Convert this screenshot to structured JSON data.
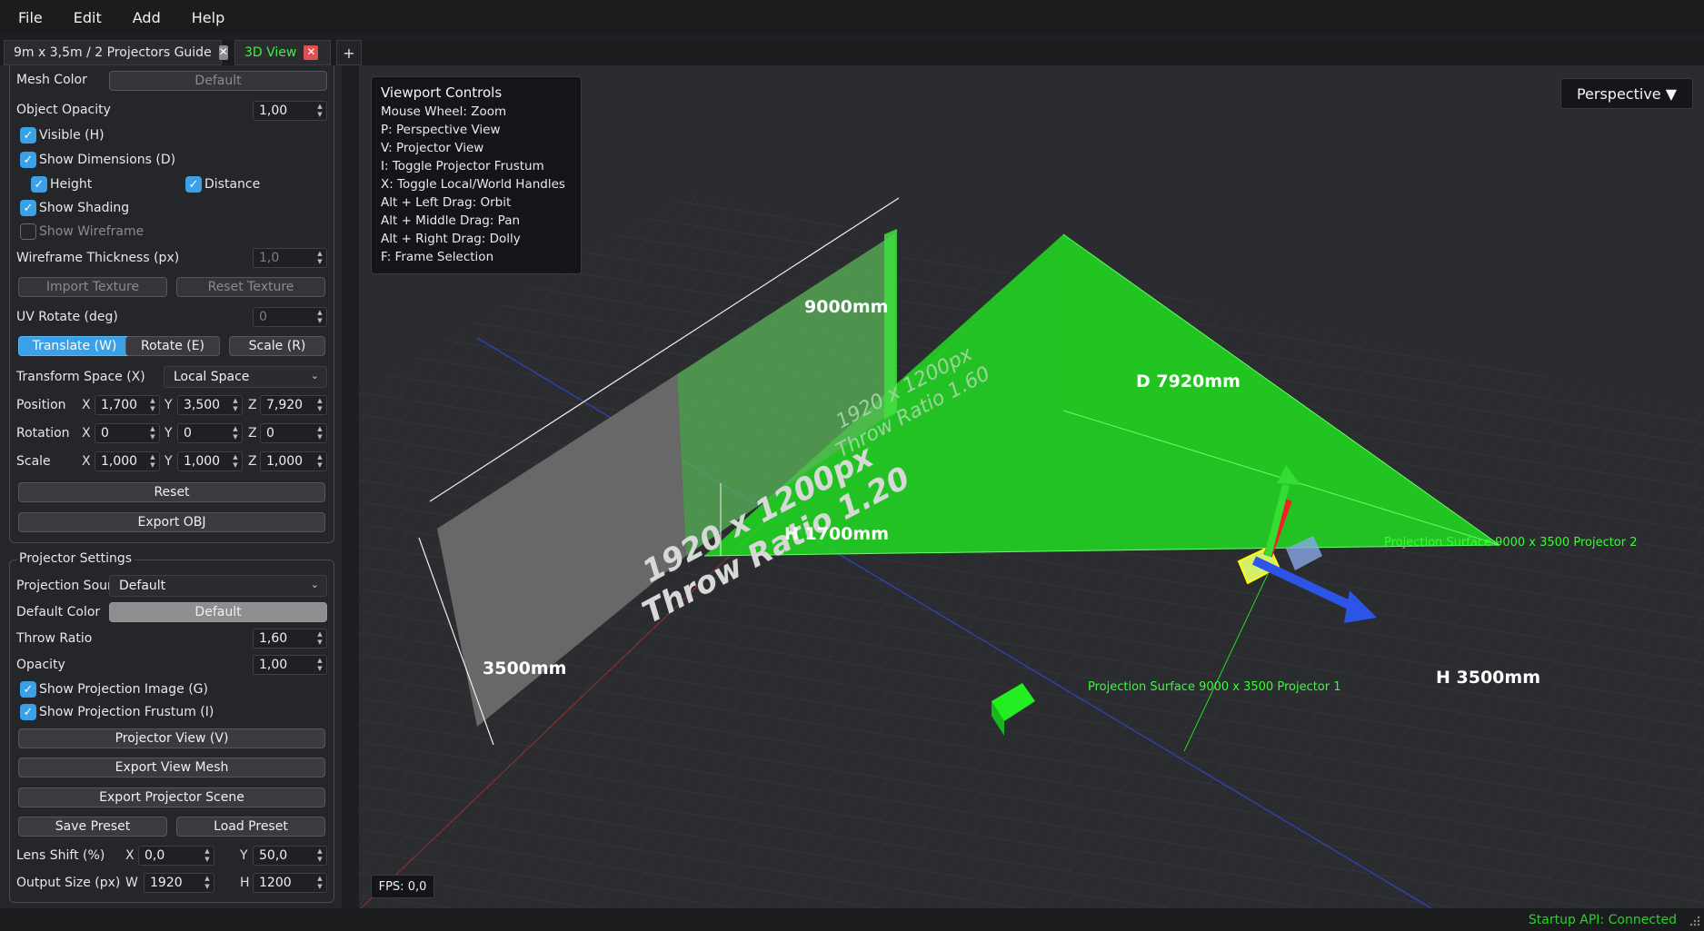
{
  "menu": {
    "file": "File",
    "edit": "Edit",
    "add": "Add",
    "help": "Help"
  },
  "tabs": {
    "guide": "9m x 3,5m / 2 Projectors Guide",
    "view3d": "3D View",
    "close": "✕",
    "add": "+"
  },
  "object": {
    "mesh_color_label": "Mesh Color",
    "mesh_color_button": "Default",
    "opacity_label": "Object Opacity",
    "opacity_value": "1,00",
    "visible": "Visible (H)",
    "show_dimensions": "Show Dimensions (D)",
    "height": "Height",
    "distance": "Distance",
    "show_shading": "Show Shading",
    "show_wireframe": "Show Wireframe",
    "wireframe_label": "Wireframe Thickness (px)",
    "wireframe_value": "1,0",
    "import_texture": "Import Texture",
    "reset_texture": "Reset Texture",
    "uv_rotate_label": "UV Rotate (deg)",
    "uv_rotate_value": "0",
    "translate": "Translate (W)",
    "rotate": "Rotate (E)",
    "scale_btn": "Scale (R)",
    "transform_space_label": "Transform Space (X)",
    "transform_space_value": "Local Space",
    "position_label": "Position",
    "rotation_label": "Rotation",
    "scale_label": "Scale",
    "axis_x": "X",
    "axis_y": "Y",
    "axis_z": "Z",
    "position": {
      "x": "1,700",
      "y": "3,500",
      "z": "7,920"
    },
    "rotation": {
      "x": "0",
      "y": "0",
      "z": "0"
    },
    "scale": {
      "x": "1,000",
      "y": "1,000",
      "z": "1,000"
    },
    "reset": "Reset",
    "export_obj": "Export OBJ"
  },
  "projector": {
    "group_title": "Projector Settings",
    "source_label": "Projection Sour",
    "source_value": "Default",
    "default_color_label": "Default Color",
    "default_color_button": "Default",
    "throw_ratio_label": "Throw Ratio",
    "throw_ratio_value": "1,60",
    "opacity_label": "Opacity",
    "opacity_value": "1,00",
    "show_image": "Show Projection Image (G)",
    "show_frustum": "Show Projection Frustum (I)",
    "projector_view": "Projector View (V)",
    "export_view_mesh": "Export View Mesh",
    "export_scene": "Export Projector Scene",
    "save_preset": "Save Preset",
    "load_preset": "Load Preset",
    "lens_shift_label": "Lens Shift (%)",
    "lens_x": "0,0",
    "lens_y": "50,0",
    "output_label": "Output Size (px)",
    "w_label": "W",
    "h_label": "H",
    "out_w": "1920",
    "out_h": "1200"
  },
  "viewport": {
    "controls_title": "Viewport Controls",
    "controls": [
      "Mouse Wheel: Zoom",
      "P: Perspective View",
      "V: Projector View",
      "I: Toggle Projector Frustum",
      "X: Toggle Local/World Handles",
      "Alt + Left Drag: Orbit",
      "Alt + Middle Drag: Pan",
      "Alt + Right Drag: Dolly",
      "F: Frame Selection"
    ],
    "view_mode": "Perspective ▼",
    "fps": "FPS: 0,0",
    "width_dim": "9000mm",
    "height_dim": "3500mm",
    "distance_dim": "D 7920mm",
    "proj_height_dim": "H 1700mm",
    "proj2_height_dim": "H 3500mm",
    "label_proj1": "Projection Surface 9000 x 3500 Projector 1",
    "label_proj2": "Projection Surface 9000 x 3500 Projector 2",
    "screen1_res": "1920 x 1200px",
    "screen1_throw": "Throw Ratio 1.20",
    "screen2_res": "1920 x 1200px",
    "screen2_throw": "Throw Ratio 1.60"
  },
  "status": {
    "api": "Startup API: Connected"
  },
  "colors": {
    "accent": "#3aa0e8",
    "frustum": "#22dd22",
    "active_tab_text": "#3cf03c",
    "status_ok": "#2ad12a"
  }
}
